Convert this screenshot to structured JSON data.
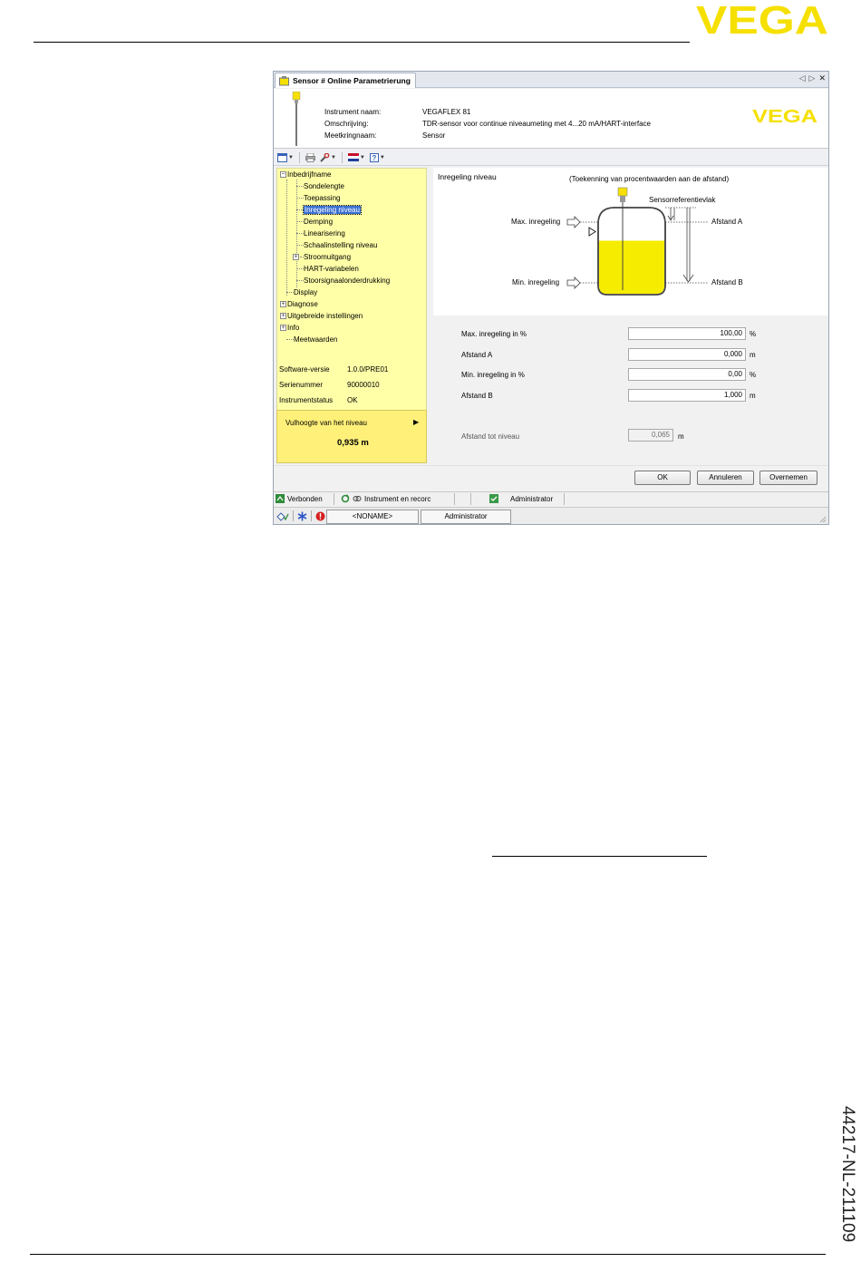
{
  "page": {
    "brand_logo_text": "VEGA",
    "document_number": "44217-NL-211109"
  },
  "window": {
    "tab_title": "Sensor # Online Parametrierung",
    "tab_controls": [
      "◁",
      "▷",
      "✕"
    ]
  },
  "device_header": {
    "labels": [
      "Instrument naam:",
      "Omschrijving:",
      "Meetkringnaam:"
    ],
    "values": [
      "VEGAFLEX 81",
      "TDR-sensor voor continue niveaumeting met 4...20 mA/HART-interface",
      "Sensor"
    ],
    "logo_text": "VEGA"
  },
  "toolbar": {
    "icons": [
      "window-layout-icon",
      "print-icon",
      "wrench-icon",
      "flag-icon",
      "help-icon"
    ]
  },
  "tree": {
    "items": [
      {
        "label": "Inbedrijfname",
        "expander": "−"
      },
      {
        "label": "Sondelengte"
      },
      {
        "label": "Toepassing"
      },
      {
        "label": "Inregeling niveau"
      },
      {
        "label": "Demping"
      },
      {
        "label": "Linearisering"
      },
      {
        "label": "Schaalinstelling niveau"
      },
      {
        "label": "Stroomuitgang",
        "expander": "+"
      },
      {
        "label": "HART-variabelen"
      },
      {
        "label": "Stoorsignaalonderdrukking"
      },
      {
        "label": "Display"
      },
      {
        "label": "Diagnose",
        "expander": "+"
      },
      {
        "label": "Uitgebreide instellingen",
        "expander": "+"
      },
      {
        "label": "Info",
        "expander": "+"
      },
      {
        "label": "Meetwaarden"
      }
    ],
    "selected": "Inregeling niveau"
  },
  "info": {
    "software_label": "Software-versie",
    "software_value": "1.0.0/PRE01",
    "serial_label": "Serienummer",
    "serial_value": "90000010",
    "status_label": "Instrumentstatus",
    "status_value": "OK"
  },
  "level_box": {
    "title": "Vulhoogte van het niveau",
    "arrow": "▶",
    "value": "0,935 m"
  },
  "diagram": {
    "title": "Inregeling niveau",
    "subtitle": "(Toekenning van procentwaarden aan de afstand)",
    "sensor_ref": "Sensorreferentievlak",
    "max_label": "Max. inregeling",
    "min_label": "Min. inregeling",
    "afstand_a": "Afstand A",
    "afstand_b": "Afstand B",
    "fill_level": 0.62
  },
  "form": {
    "max_label": "Max. inregeling in %",
    "max_value": "100,00",
    "max_unit": "%",
    "a_label": "Afstand A",
    "a_value": "0,000",
    "a_unit": "m",
    "min_label": "Min. inregeling in %",
    "min_value": "0,00",
    "min_unit": "%",
    "b_label": "Afstand B",
    "b_value": "1,000",
    "b_unit": "m",
    "dist_label": "Afstand tot niveau",
    "dist_value": "0,065",
    "dist_unit": "m"
  },
  "buttons": {
    "ok": "OK",
    "cancel": "Annuleren",
    "apply": "Overnemen"
  },
  "statusbar": {
    "connected": "Verbonden",
    "instrument": "Instrument en recorc",
    "user": "Administrator"
  },
  "bottombar": {
    "project": "<NONAME>",
    "user": "Administrator"
  },
  "colors": {
    "brand_yellow": "#f6e000",
    "tree_bg": "#ffffa8",
    "level_box_bg": "#fff07a",
    "selection_blue": "#3a6fd0"
  }
}
